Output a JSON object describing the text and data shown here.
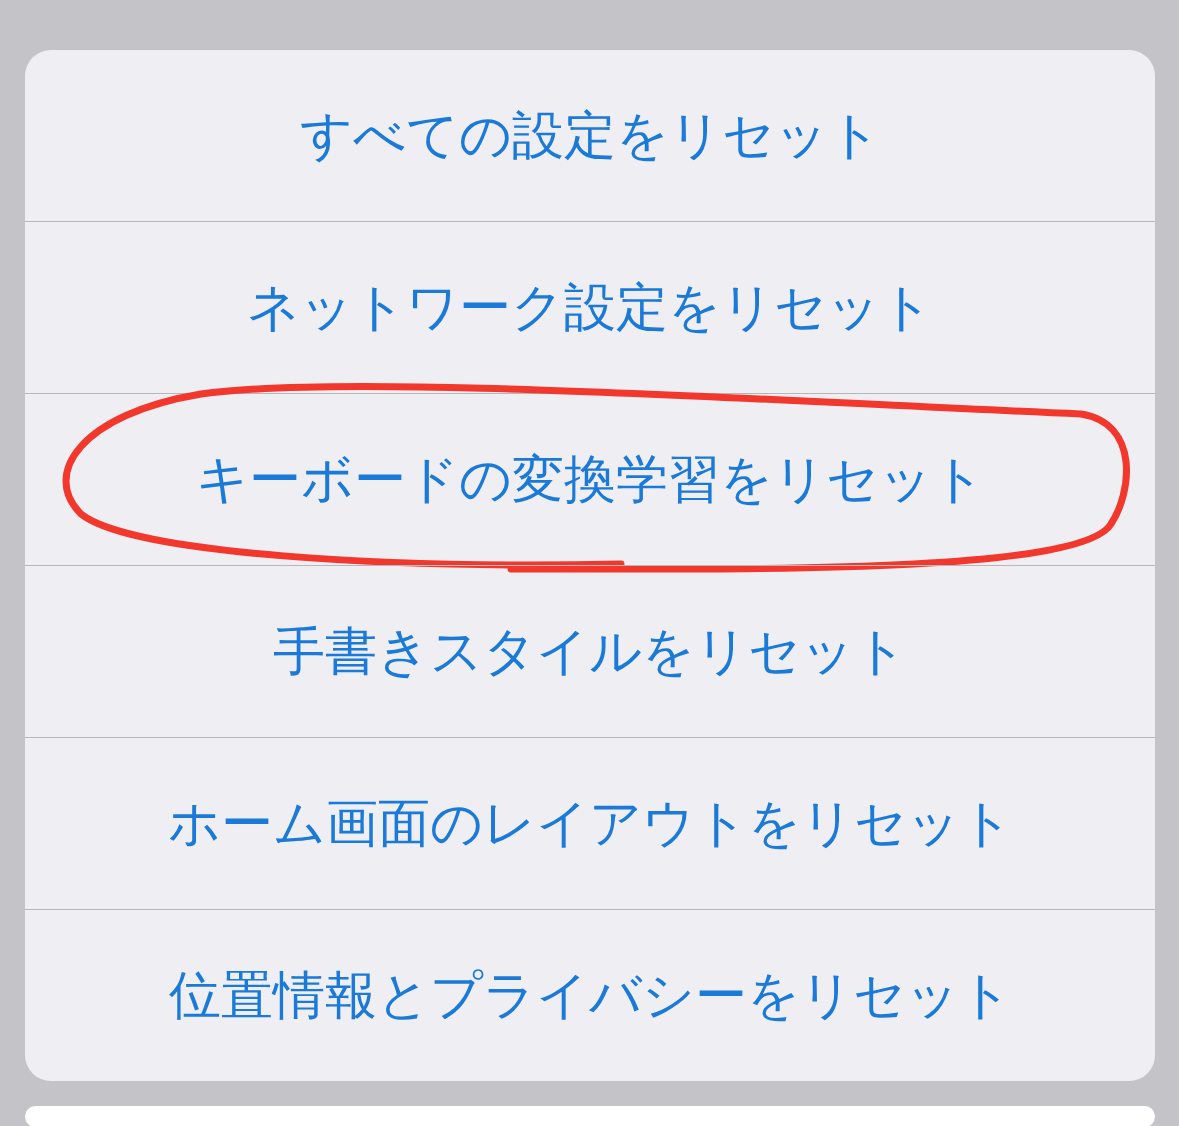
{
  "action_sheet": {
    "items": [
      {
        "label": "すべての設定をリセット",
        "circled": false
      },
      {
        "label": "ネットワーク設定をリセット",
        "circled": false
      },
      {
        "label": "キーボードの変換学習をリセット",
        "circled": true
      },
      {
        "label": "手書きスタイルをリセット",
        "circled": false
      },
      {
        "label": "ホーム画面のレイアウトをリセット",
        "circled": false
      },
      {
        "label": "位置情報とプライバシーをリセット",
        "circled": false
      }
    ]
  }
}
